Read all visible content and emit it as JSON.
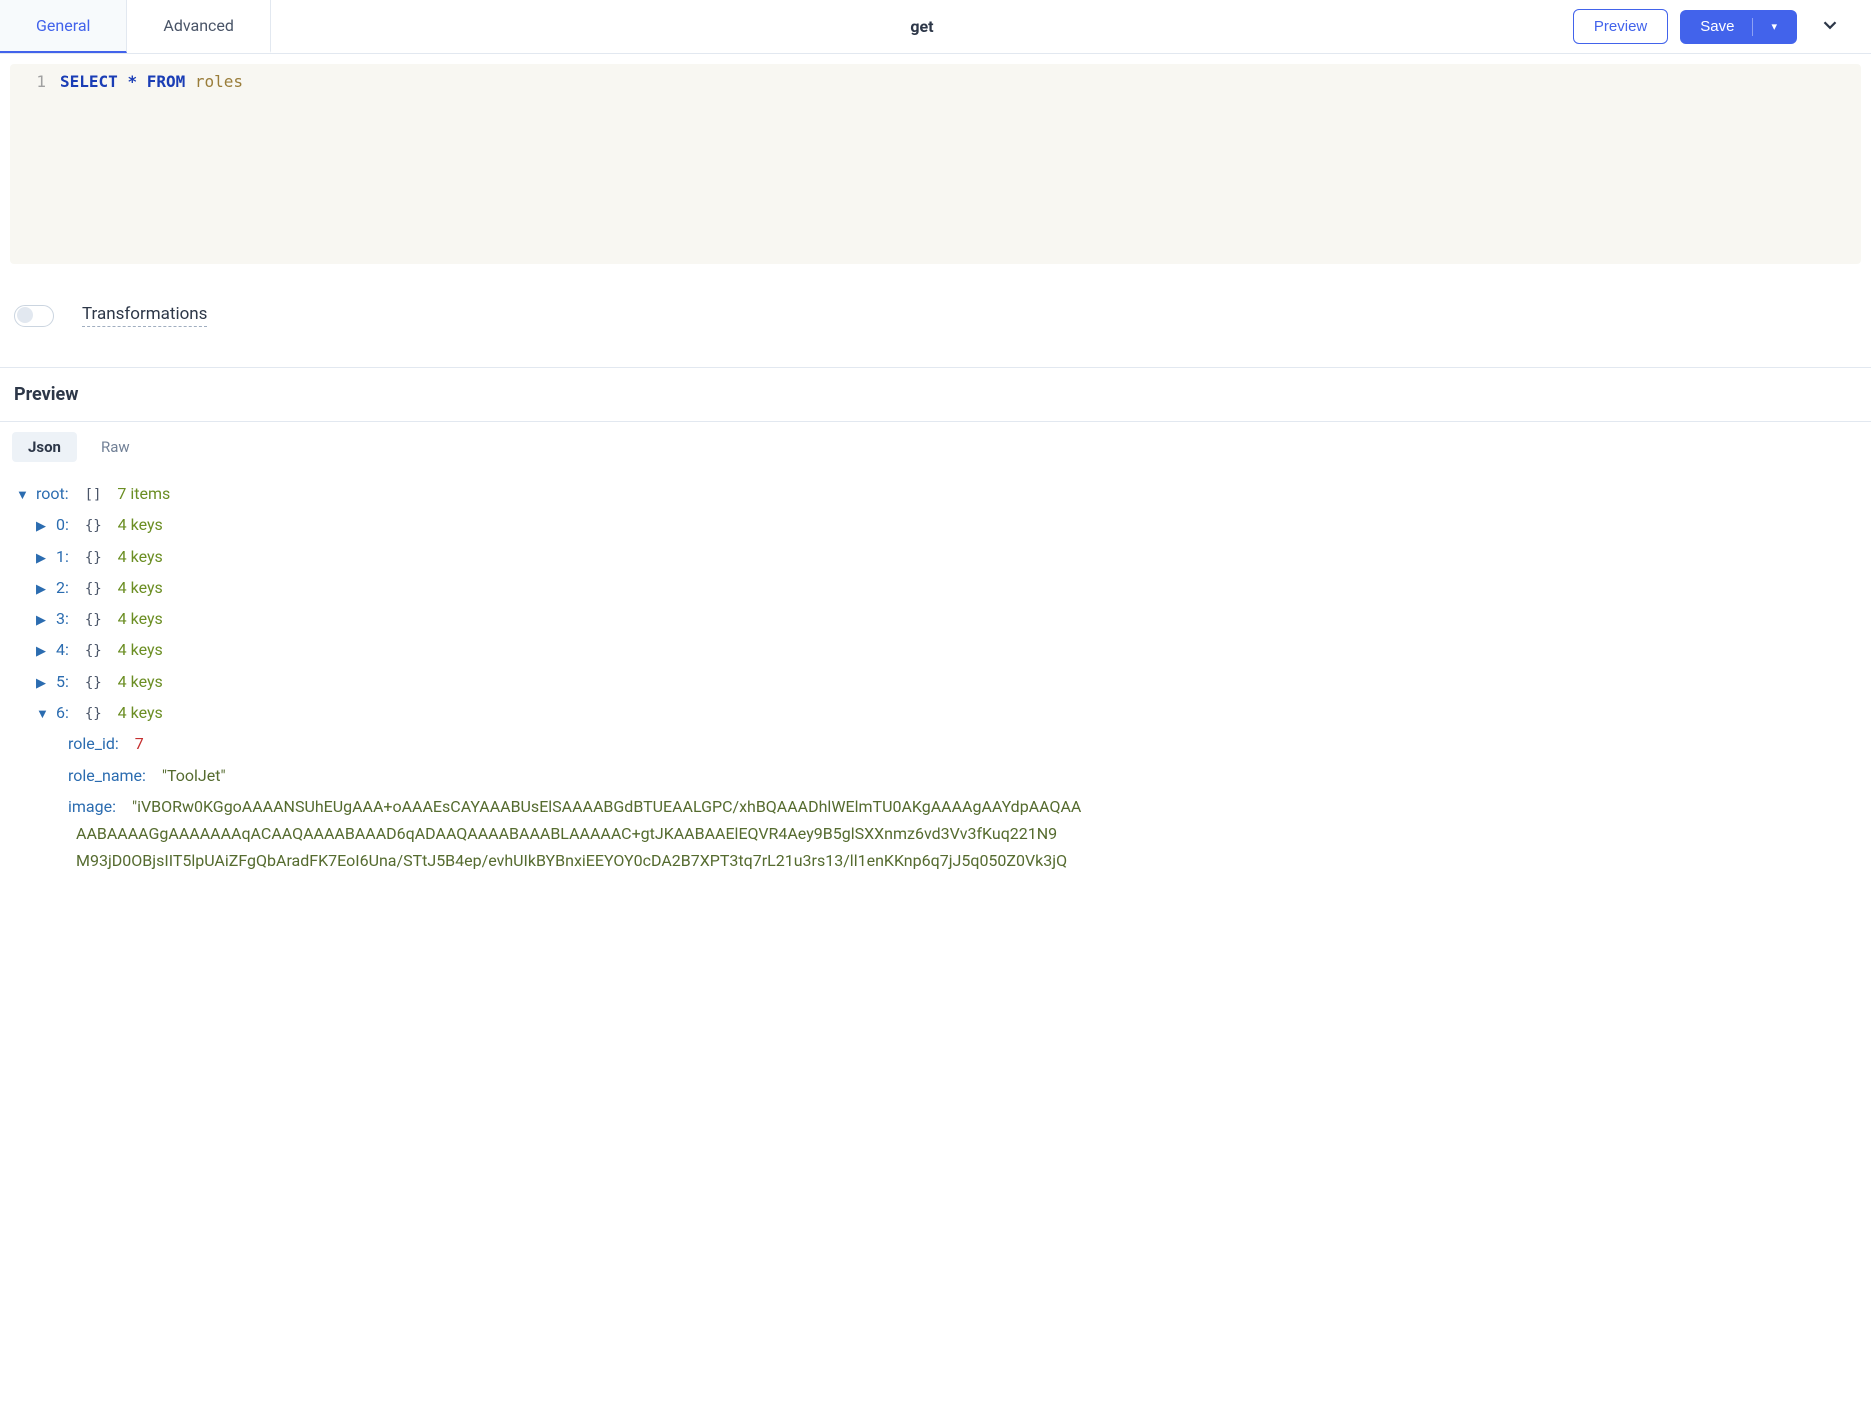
{
  "header": {
    "tabs": {
      "general": "General",
      "advanced": "Advanced"
    },
    "title": "get",
    "preview_button": "Preview",
    "save_button": "Save"
  },
  "editor": {
    "line_number": "1",
    "kw_select": "SELECT",
    "op_star": "*",
    "kw_from": "FROM",
    "ident_roles": "roles"
  },
  "transformations": {
    "label": "Transformations"
  },
  "preview": {
    "title": "Preview",
    "tabs": {
      "json": "Json",
      "raw": "Raw"
    }
  },
  "tree": {
    "root_label": "root:",
    "root_bracket": "[]",
    "root_summary": "7 items",
    "items": [
      {
        "key": "0:",
        "bracket": "{}",
        "summary": "4 keys"
      },
      {
        "key": "1:",
        "bracket": "{}",
        "summary": "4 keys"
      },
      {
        "key": "2:",
        "bracket": "{}",
        "summary": "4 keys"
      },
      {
        "key": "3:",
        "bracket": "{}",
        "summary": "4 keys"
      },
      {
        "key": "4:",
        "bracket": "{}",
        "summary": "4 keys"
      },
      {
        "key": "5:",
        "bracket": "{}",
        "summary": "4 keys"
      },
      {
        "key": "6:",
        "bracket": "{}",
        "summary": "4 keys"
      }
    ],
    "expanded": {
      "role_id_key": "role_id:",
      "role_id_value": "7",
      "role_name_key": "role_name:",
      "role_name_value": "\"ToolJet\"",
      "image_key": "image:",
      "image_line1": "\"iVBORw0KGgoAAAANSUhEUgAAA+oAAAEsCAYAAABUsElSAAAABGdBTUEAALGPC/xhBQAAADhlWElmTU0AKgAAAAgAAYdpAAQAA",
      "image_line2": "AABAAAAGgAAAAAAAqACAAQAAAABAAAD6qADAAQAAAABAAABLAAAAAC+gtJKAABAAElEQVR4Aey9B5glSXXnmz6vd3Vv3fKuq221N9",
      "image_line3": "M93jD0OBjsIIT5lpUAiZFgQbAradFK7EoI6Una/STtJ5B4ep/evhUIkBYBnxiEEYOY0cDA2B7XPT3tq7rL21u3rs13/ll1enKKnp6q7jJ5q050Z0Vk3jQ"
    }
  }
}
